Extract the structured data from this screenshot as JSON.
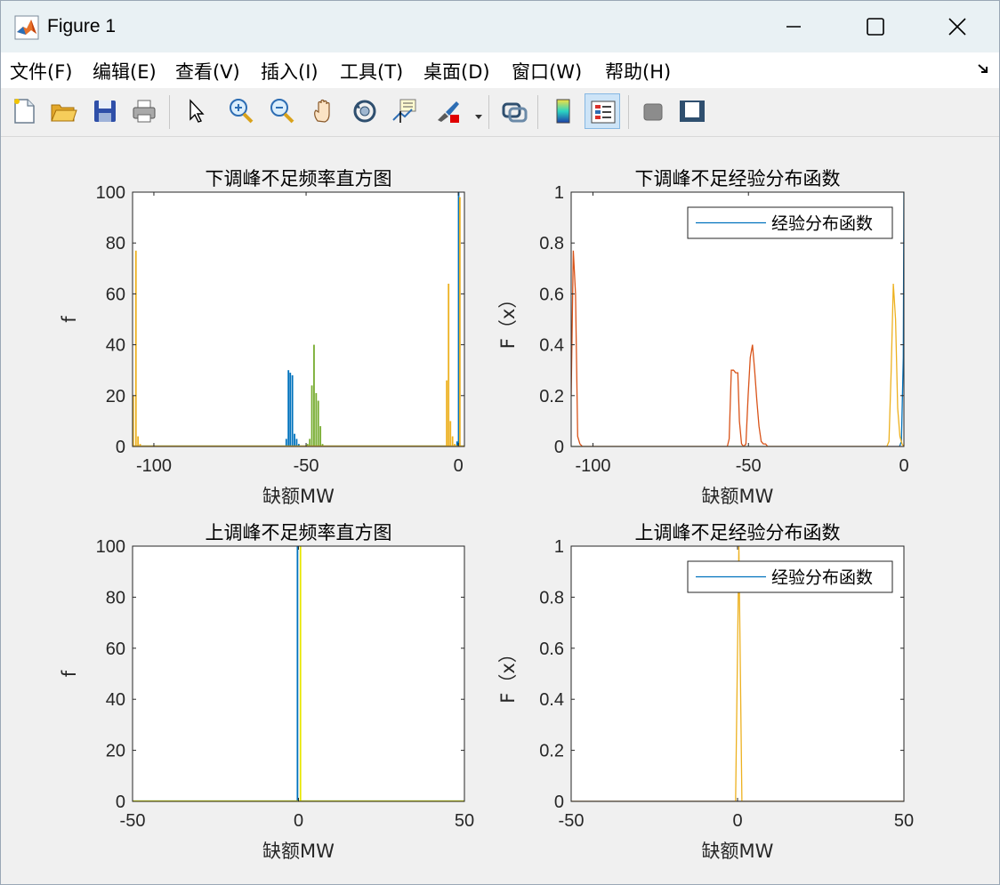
{
  "window": {
    "title": "Figure 1",
    "minimize_icon": "minimize-icon",
    "maximize_icon": "maximize-icon",
    "close_icon": "close-icon"
  },
  "menu": [
    {
      "label": "文件(F)"
    },
    {
      "label": "编辑(E)"
    },
    {
      "label": "查看(V)"
    },
    {
      "label": "插入(I)"
    },
    {
      "label": "工具(T)"
    },
    {
      "label": "桌面(D)"
    },
    {
      "label": "窗口(W)"
    },
    {
      "label": "帮助(H)"
    }
  ],
  "toolbar": [
    "new-figure-icon",
    "open-file-icon",
    "save-icon",
    "print-icon",
    "pointer-icon",
    "zoom-in-icon",
    "zoom-out-icon",
    "pan-icon",
    "rotate-3d-icon",
    "data-cursor-icon",
    "brush-icon",
    "link-plot-icon",
    "colorbar-icon",
    "legend-icon",
    "hide-plot-tools-icon",
    "show-plot-tools-icon"
  ],
  "colors": {
    "blue": "#0072BD",
    "orange": "#D95319",
    "yellow": "#EDB120",
    "green": "#77AC30",
    "bright_yellow": "#E8E600"
  },
  "chart_data": [
    {
      "type": "bar",
      "title": "下调峰不足频率直方图",
      "xlabel": "缺额MW",
      "ylabel": "f",
      "xlim": [
        -107,
        2
      ],
      "ylim": [
        0,
        100
      ],
      "xticks": [
        -100,
        -50,
        0
      ],
      "yticks": [
        0,
        20,
        40,
        60,
        80,
        100
      ],
      "series": [
        {
          "color": "blue",
          "x": [
            -56.5,
            -55.8,
            -55.2,
            -54.5,
            -53.8,
            -53.1,
            -52.4,
            -0.4,
            0.1
          ],
          "values": [
            3,
            30,
            29,
            28,
            5,
            3,
            1,
            2,
            100
          ]
        },
        {
          "color": "green",
          "x": [
            -49.5,
            -48.8,
            -48.1,
            -47.4,
            -46.7,
            -46.0,
            -45.3,
            -44.6
          ],
          "values": [
            1,
            3,
            24,
            40,
            21,
            18,
            8,
            1
          ]
        },
        {
          "color": "yellow",
          "x": [
            -106.8,
            -105.9,
            -105.2,
            -104.5,
            -3.8,
            -3.2,
            -2.6,
            -1.9,
            -1.2,
            0.5
          ],
          "values": [
            20,
            77,
            4,
            1,
            26,
            64,
            10,
            4,
            1,
            98
          ]
        }
      ]
    },
    {
      "type": "line",
      "title": "下调峰不足经验分布函数",
      "xlabel": "缺额MW",
      "ylabel": "F（x）",
      "xlim": [
        -107,
        0
      ],
      "ylim": [
        0,
        1
      ],
      "xticks": [
        -100,
        -50,
        0
      ],
      "yticks": [
        0,
        0.2,
        0.4,
        0.6,
        0.8,
        1
      ],
      "legend": {
        "entries": [
          "经验分布函数"
        ],
        "location": "top-right"
      },
      "series": [
        {
          "name": "经验分布函数",
          "color": "blue",
          "x": [
            -107,
            -1.4,
            -0.8,
            -0.2,
            0
          ],
          "y": [
            0,
            0,
            0.02,
            0.35,
            1
          ]
        },
        {
          "color": "orange",
          "x": [
            -107,
            -106.3,
            -105.6,
            -104.9,
            -104.2,
            -103.4,
            -102,
            -100,
            -56.8,
            -56.2,
            -55.5,
            -54.8,
            -54.1,
            -53.4,
            -52.9,
            -52.2,
            -51.5,
            -50.8,
            -50.1,
            -49.4,
            -48.7,
            -48,
            -47.3,
            -46.6,
            -45.9,
            -45.2,
            -44.5,
            -43.8,
            0
          ],
          "y": [
            0.2,
            0.77,
            0.6,
            0.04,
            0.01,
            0,
            0,
            0,
            0,
            0.03,
            0.3,
            0.3,
            0.29,
            0.29,
            0.1,
            0.01,
            0,
            0.01,
            0.2,
            0.35,
            0.4,
            0.3,
            0.18,
            0.08,
            0.02,
            0.01,
            0.01,
            0,
            0
          ]
        },
        {
          "color": "yellow",
          "x": [
            -107,
            -5.5,
            -4.8,
            -4.1,
            -3.4,
            -2.7,
            -2,
            -1.3,
            -0.6,
            0
          ],
          "y": [
            0,
            0,
            0.02,
            0.3,
            0.64,
            0.5,
            0.15,
            0.04,
            0.01,
            0
          ]
        }
      ]
    },
    {
      "type": "bar",
      "title": "上调峰不足频率直方图",
      "xlabel": "缺额MW",
      "ylabel": "f",
      "xlim": [
        -50,
        50
      ],
      "ylim": [
        0,
        100
      ],
      "xticks": [
        -50,
        0,
        50
      ],
      "yticks": [
        0,
        20,
        40,
        60,
        80,
        100
      ],
      "series": [
        {
          "color": "blue",
          "x": [
            -0.3
          ],
          "values": [
            100
          ]
        },
        {
          "color": "bright_yellow",
          "x": [
            0.6
          ],
          "values": [
            100
          ]
        }
      ]
    },
    {
      "type": "line",
      "title": "上调峰不足经验分布函数",
      "xlabel": "缺额MW",
      "ylabel": "F（x）",
      "xlim": [
        -50,
        50
      ],
      "ylim": [
        0,
        1
      ],
      "xticks": [
        -50,
        0,
        50
      ],
      "yticks": [
        0,
        0.2,
        0.4,
        0.6,
        0.8,
        1
      ],
      "legend": {
        "entries": [
          "经验分布函数"
        ],
        "location": "top-right"
      },
      "series": [
        {
          "name": "经验分布函数",
          "color": "blue",
          "x": [
            -50,
            50
          ],
          "y": [
            0,
            0
          ]
        },
        {
          "color": "orange",
          "x": [
            -50,
            50
          ],
          "y": [
            0,
            0
          ]
        },
        {
          "color": "yellow",
          "x": [
            -50,
            -0.6,
            0.4,
            1.3,
            50
          ],
          "y": [
            0,
            0,
            1,
            0,
            0
          ]
        }
      ]
    }
  ]
}
